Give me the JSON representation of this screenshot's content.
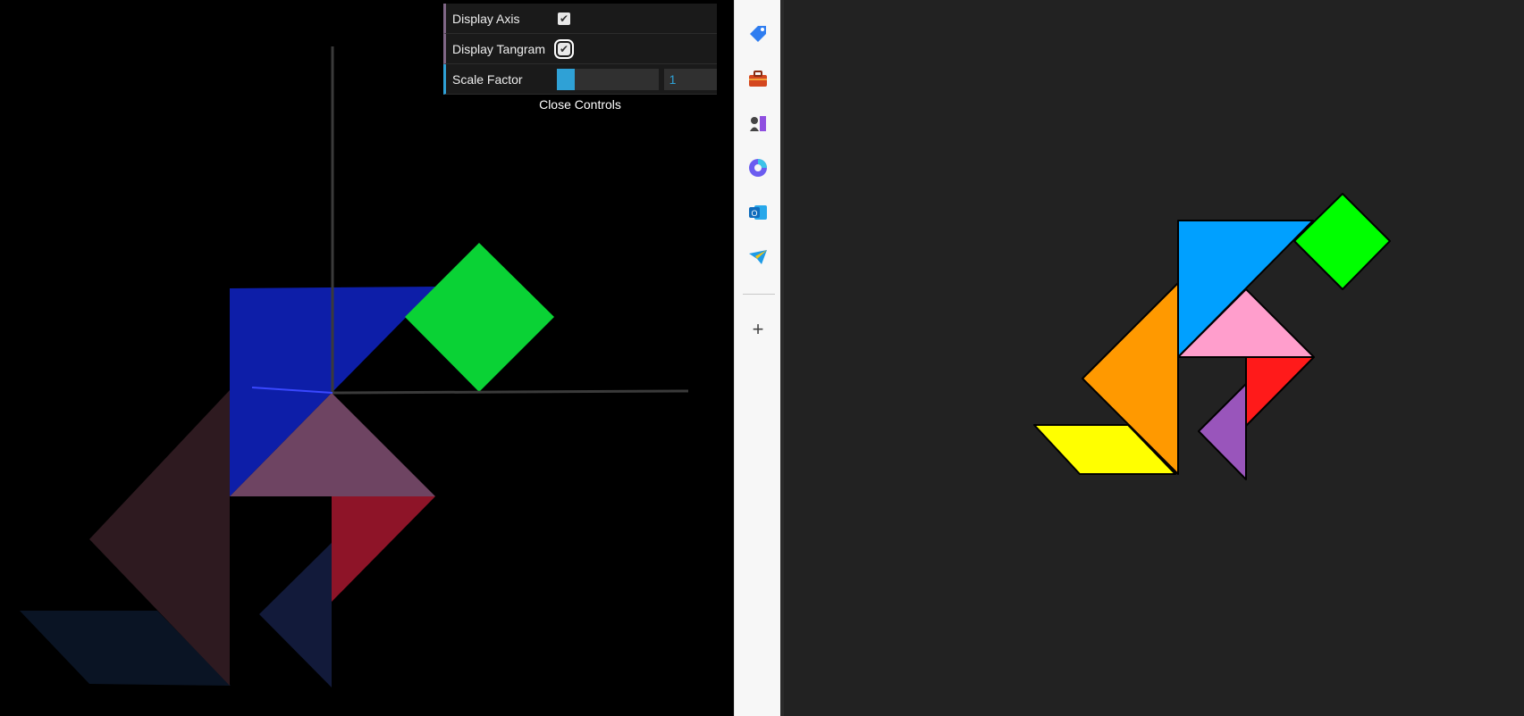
{
  "gui": {
    "display_axis_label": "Display Axis",
    "display_axis_checked": true,
    "display_tangram_label": "Display Tangram",
    "display_tangram_checked": true,
    "scale_factor_label": "Scale Factor",
    "scale_factor_value": "1",
    "scale_factor_fraction": 0.18,
    "close_label": "Close Controls",
    "check_glyph": "✔"
  },
  "sidebar": {
    "items": [
      {
        "name": "tag-icon",
        "color": "#2f7df0"
      },
      {
        "name": "toolbox-icon",
        "color": "#d4471f"
      },
      {
        "name": "chess-icon",
        "color": "#6a3ea1"
      },
      {
        "name": "copilot-icon",
        "color": "#6b5cf0"
      },
      {
        "name": "outlook-icon",
        "color": "#0f6cbd"
      },
      {
        "name": "send-icon",
        "color": "#1e9be6"
      }
    ],
    "add_glyph": "+"
  },
  "colors": {
    "blue_large": "#00a0ff",
    "green_square": "#00ff00",
    "pink_triangle": "#ff9ecc",
    "orange_triangle": "#ff9900",
    "yellow_parallelogram": "#ffff00",
    "red_triangle": "#ff1a1a",
    "purple_triangle": "#9955bb"
  }
}
